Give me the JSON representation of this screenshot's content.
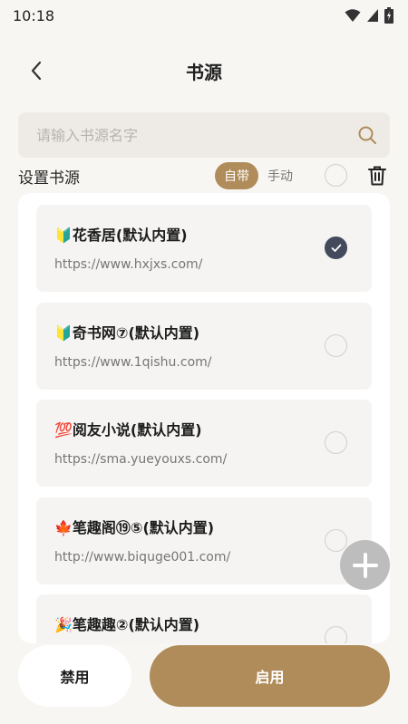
{
  "status_bar": {
    "time": "10:18"
  },
  "header": {
    "title": "书源"
  },
  "search": {
    "placeholder": "请输入书源名字"
  },
  "section": {
    "title": "设置书源",
    "segments": [
      {
        "label": "自带",
        "active": true
      },
      {
        "label": "手动",
        "active": false
      }
    ]
  },
  "sources": [
    {
      "icon": "🔰",
      "name": "花香居(默认内置)",
      "url": "https://www.hxjxs.com/",
      "checked": true
    },
    {
      "icon": "🔰",
      "name": "奇书网⑦(默认内置)",
      "url": "https://www.1qishu.com/",
      "checked": false
    },
    {
      "icon": "💯",
      "name": "阅友小说(默认内置)",
      "url": "https://sma.yueyouxs.com/",
      "checked": false
    },
    {
      "icon": "🍁",
      "name": "笔趣阁⑲⑤(默认内置)",
      "url": "http://www.biquge001.com/",
      "checked": false
    },
    {
      "icon": "🎉",
      "name": "笔趣趣②(默认内置)",
      "url": "",
      "checked": false
    }
  ],
  "buttons": {
    "disable": "禁用",
    "enable": "启用"
  },
  "colors": {
    "accent": "#b08c5a",
    "checked": "#424a5c",
    "background": "#f8f6f3"
  }
}
